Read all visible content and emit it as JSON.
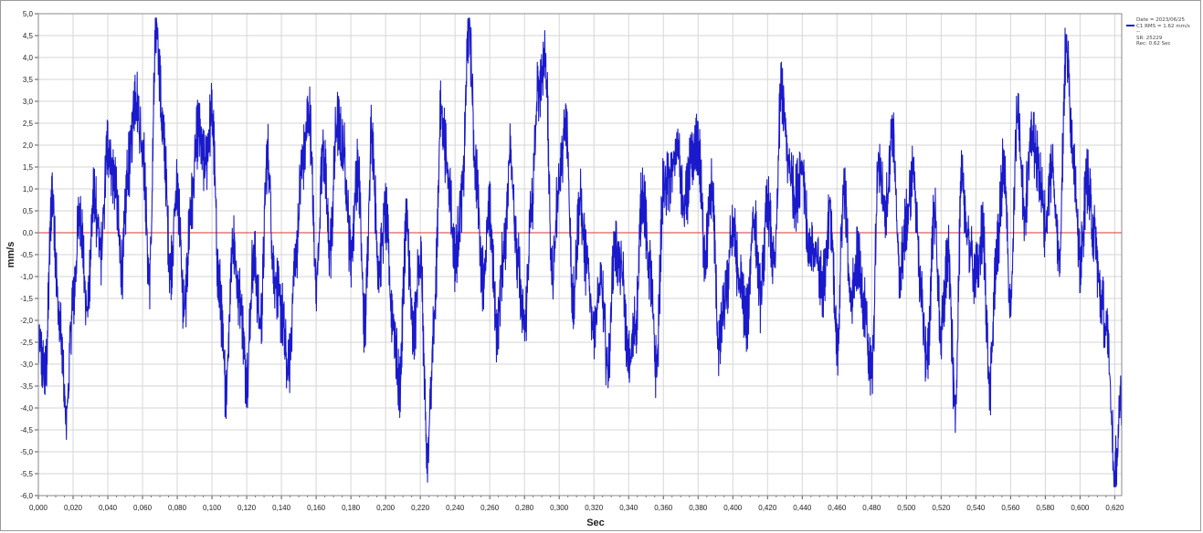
{
  "chart_data": {
    "type": "line",
    "title": "",
    "xlabel": "Sec",
    "ylabel": "mm/s",
    "xlim": [
      0.0,
      0.624
    ],
    "ylim": [
      -6.0,
      5.0
    ],
    "grid": true,
    "legend_placement": "top-right",
    "x_ticks": [
      "0,000",
      "0,020",
      "0,040",
      "0,060",
      "0,080",
      "0,100",
      "0,120",
      "0,140",
      "0,160",
      "0,180",
      "0,200",
      "0,220",
      "0,240",
      "0,260",
      "0,280",
      "0,300",
      "0,320",
      "0,340",
      "0,360",
      "0,380",
      "0,400",
      "0,420",
      "0,440",
      "0,460",
      "0,480",
      "0,500",
      "0,520",
      "0,540",
      "0,560",
      "0,580",
      "0,600",
      "0,620"
    ],
    "y_ticks": [
      "5,0",
      "4,5",
      "4,0",
      "3,5",
      "3,0",
      "2,5",
      "2,0",
      "1,5",
      "1,0",
      "0,5",
      "0,0",
      "-0,5",
      "-1,0",
      "-1,5",
      "-2,0",
      "-2,5",
      "-3,0",
      "-3,5",
      "-4,0",
      "-4,5",
      "-5,0",
      "-5,5",
      "-6,0"
    ],
    "reference_line": {
      "y": 0.0,
      "color": "#e03030"
    },
    "series": [
      {
        "name": "C1 RMS = 1.62 mm/s",
        "color": "#1a1acc",
        "x": [
          0.0,
          0.004,
          0.008,
          0.012,
          0.016,
          0.02,
          0.024,
          0.028,
          0.032,
          0.036,
          0.04,
          0.044,
          0.048,
          0.052,
          0.056,
          0.06,
          0.064,
          0.068,
          0.072,
          0.076,
          0.08,
          0.084,
          0.088,
          0.092,
          0.096,
          0.1,
          0.104,
          0.108,
          0.112,
          0.116,
          0.12,
          0.124,
          0.128,
          0.132,
          0.136,
          0.14,
          0.144,
          0.148,
          0.152,
          0.156,
          0.16,
          0.164,
          0.168,
          0.172,
          0.176,
          0.18,
          0.184,
          0.188,
          0.192,
          0.196,
          0.2,
          0.204,
          0.208,
          0.212,
          0.216,
          0.22,
          0.224,
          0.228,
          0.232,
          0.236,
          0.24,
          0.244,
          0.248,
          0.252,
          0.256,
          0.26,
          0.264,
          0.268,
          0.272,
          0.276,
          0.28,
          0.284,
          0.288,
          0.292,
          0.296,
          0.3,
          0.304,
          0.308,
          0.312,
          0.316,
          0.32,
          0.324,
          0.328,
          0.332,
          0.336,
          0.34,
          0.344,
          0.348,
          0.352,
          0.356,
          0.36,
          0.364,
          0.368,
          0.372,
          0.376,
          0.38,
          0.384,
          0.388,
          0.392,
          0.396,
          0.4,
          0.404,
          0.408,
          0.412,
          0.416,
          0.42,
          0.424,
          0.428,
          0.432,
          0.436,
          0.44,
          0.444,
          0.448,
          0.452,
          0.456,
          0.46,
          0.464,
          0.468,
          0.472,
          0.476,
          0.48,
          0.484,
          0.488,
          0.492,
          0.496,
          0.5,
          0.504,
          0.508,
          0.512,
          0.516,
          0.52,
          0.524,
          0.528,
          0.532,
          0.536,
          0.54,
          0.544,
          0.548,
          0.552,
          0.556,
          0.56,
          0.564,
          0.568,
          0.572,
          0.576,
          0.58,
          0.584,
          0.588,
          0.592,
          0.596,
          0.6,
          0.604,
          0.608,
          0.612,
          0.616,
          0.62,
          0.624
        ],
        "y": [
          -2.5,
          -3.3,
          0.9,
          -2.0,
          -4.2,
          -1.5,
          0.5,
          -1.8,
          0.8,
          -0.5,
          2.0,
          1.2,
          -0.8,
          1.5,
          3.2,
          2.0,
          -1.0,
          4.8,
          2.2,
          -0.8,
          1.0,
          -1.8,
          0.6,
          2.3,
          1.5,
          2.7,
          -1.2,
          -3.5,
          -0.2,
          -1.5,
          -3.3,
          -0.5,
          -2.1,
          1.8,
          -1.0,
          -1.8,
          -3.2,
          -0.7,
          1.6,
          2.7,
          -1.1,
          1.9,
          -0.4,
          2.5,
          1.8,
          -0.5,
          1.5,
          -2.1,
          2.3,
          -0.8,
          0.4,
          -1.9,
          -3.5,
          0.2,
          -2.4,
          -0.5,
          -5.2,
          -2.0,
          2.8,
          1.4,
          -0.6,
          0.8,
          4.7,
          1.4,
          -1.0,
          0.4,
          -2.2,
          -0.5,
          1.9,
          -0.7,
          -2.2,
          0.5,
          3.3,
          4.0,
          -1.0,
          1.2,
          2.4,
          -1.5,
          0.7,
          -0.8,
          -2.1,
          -1.2,
          -3.0,
          -0.3,
          -0.9,
          -3.0,
          -2.1,
          1.0,
          -0.8,
          -3.1,
          1.0,
          1.2,
          2.0,
          0.5,
          1.5,
          2.0,
          -0.5,
          1.0,
          -2.6,
          -1.5,
          0.2,
          -1.2,
          -2.0,
          0.4,
          -1.5,
          0.6,
          -0.8,
          3.3,
          1.6,
          0.8,
          1.6,
          -0.5,
          -0.5,
          -1.2,
          0.5,
          -2.6,
          1.0,
          -1.5,
          -0.5,
          -1.8,
          -3.3,
          1.6,
          0.5,
          2.5,
          -1.0,
          0.2,
          1.5,
          -1.2,
          -3.0,
          0.5,
          -2.3,
          -0.5,
          -3.9,
          1.2,
          -0.3,
          -1.0,
          0.0,
          -3.5,
          -0.5,
          1.5,
          -1.6,
          2.7,
          0.5,
          2.3,
          1.5,
          0.2,
          1.5,
          -0.5,
          4.2,
          2.0,
          -0.8,
          1.2,
          0.0,
          -1.5,
          -2.5,
          -5.5,
          -3.8
        ]
      }
    ]
  },
  "legend": {
    "line1": "Date = 2023/06/25",
    "line2": "C1 RMS = 1.62 mm/s",
    "line3": "--",
    "line4": "SR: 25229",
    "line5": "Rec: 0.62 Sec"
  }
}
